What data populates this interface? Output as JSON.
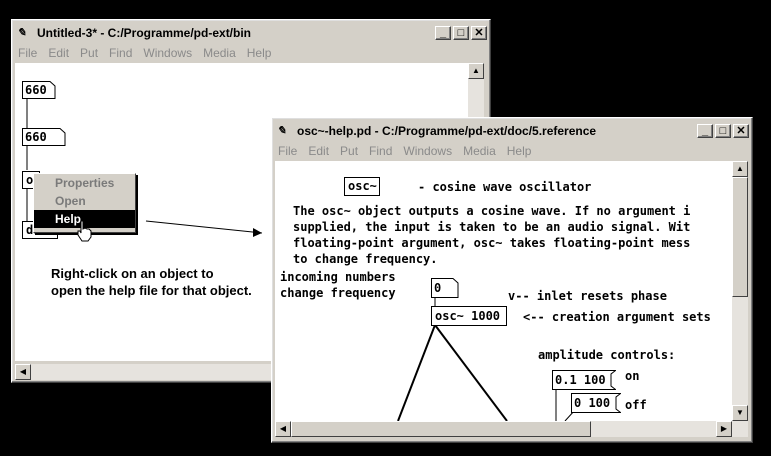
{
  "win1": {
    "title": "Untitled-3* - C:/Programme/pd-ext/bin",
    "menu": [
      "File",
      "Edit",
      "Put",
      "Find",
      "Windows",
      "Media",
      "Help"
    ],
    "numbox_top": "660",
    "numbox_mid": "660",
    "obj_partial": "o",
    "obj_bottom": "dac"
  },
  "context_menu": {
    "items": [
      "Properties",
      "Open",
      "Help"
    ],
    "highlighted": "Help"
  },
  "caption": {
    "line1": "Right-click on an object to",
    "line2": "open the help file for that object."
  },
  "win2": {
    "title": "osc~-help.pd  - C:/Programme/pd-ext/doc/5.reference",
    "menu": [
      "File",
      "Edit",
      "Put",
      "Find",
      "Windows",
      "Media",
      "Help"
    ],
    "osc_title_obj": "osc~",
    "heading": "- cosine wave oscillator",
    "desc": [
      "The osc~ object outputs a cosine wave. If no argument i",
      "supplied, the input is taken to be an audio signal. Wit",
      "floating-point argument, osc~ takes floating-point mess",
      "to change frequency."
    ],
    "incoming1": "incoming numbers",
    "incoming2": "change frequency",
    "numbox": "0",
    "inlet_note": "v-- inlet resets phase",
    "osc_obj": "osc~ 1000",
    "creation_note": "<-- creation argument sets",
    "amp_label": "amplitude controls:",
    "msg1": "0.1 100",
    "on": "on",
    "msg2": "0 100",
    "off": "off"
  },
  "window_buttons": {
    "minimize": "_",
    "maximize": "□",
    "close": "✕"
  },
  "icons": {
    "app": "pd-icon",
    "arrow_up": "▲",
    "arrow_down": "▼",
    "arrow_left": "◀",
    "arrow_right": "▶"
  }
}
